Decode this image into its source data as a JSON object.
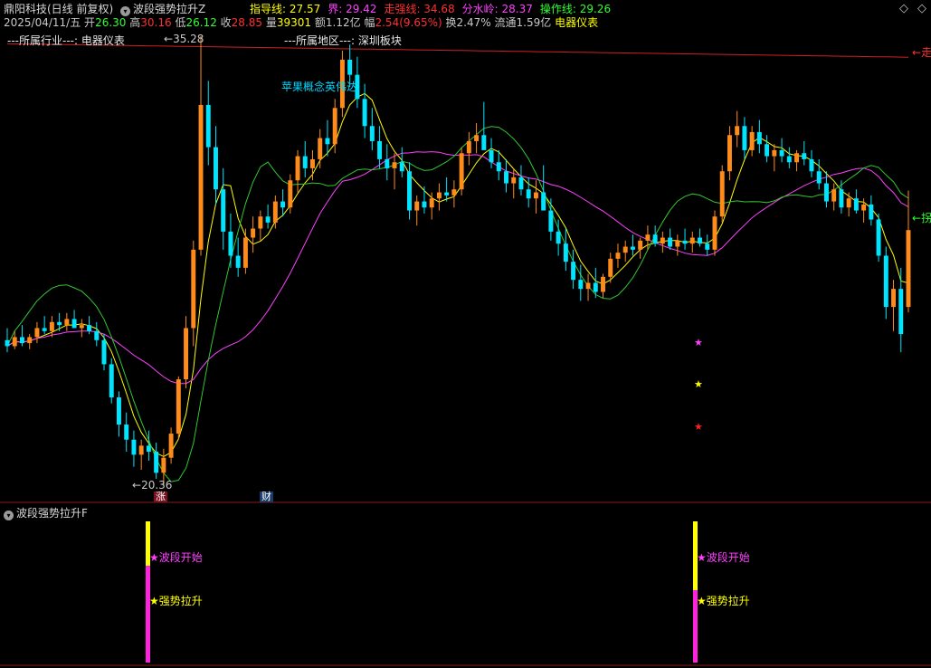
{
  "header": {
    "title": "鼎阳科技(日线 前复权)",
    "indicator_name": "波段强势拉升Z",
    "indicators": [
      {
        "label": "指导线:",
        "value": "27.57",
        "color": "#ffff00"
      },
      {
        "label": "界:",
        "value": "29.42",
        "color": "#ff40ff"
      },
      {
        "label": "走强线:",
        "value": "34.68",
        "color": "#ff3030"
      },
      {
        "label": "分水岭:",
        "value": "28.37",
        "color": "#ff40ff"
      },
      {
        "label": "操作线:",
        "value": "29.26",
        "color": "#30ff30"
      }
    ],
    "expand_icon": "diamond-icon"
  },
  "quote": {
    "date": "2025/04/11/五",
    "open_label": "开",
    "open": "26.30",
    "high_label": "高",
    "high": "30.16",
    "low_label": "低",
    "low": "26.12",
    "close_label": "收",
    "close": "28.85",
    "volume_label": "量",
    "volume": "39301",
    "amount_label": "额",
    "amount": "1.12亿",
    "change_label": "幅",
    "change": "2.54(9.65%)",
    "turnover_label": "换",
    "turnover": "2.47%",
    "float_label": "流通",
    "float": "1.59亿",
    "industry": "电器仪表"
  },
  "info": {
    "industry_line": "---所属行业---: 电器仪表",
    "region_line": "---所属地区---: 深圳板块",
    "concept_text": "苹果概念英伟达"
  },
  "chart_labels": {
    "high_marker": "35.28",
    "low_marker": "20.36",
    "right_red_label": "走",
    "right_green_label": "拐",
    "badge_zhang": "涨",
    "badge_cai": "财"
  },
  "sub_panel": {
    "title": "波段强势拉升F",
    "signal_start": "波段开始",
    "signal_strong": "强势拉升"
  },
  "colors": {
    "up": "#ff8c1a",
    "down": "#00e5ff",
    "yellow": "#ffff00",
    "magenta": "#ff40ff",
    "green": "#30c830",
    "red": "#ff3030"
  },
  "chart_data": {
    "type": "candlestick",
    "ylim": [
      20.36,
      35.28
    ],
    "series": [
      {
        "name": "指导线",
        "color": "#ffff00",
        "last": 27.57
      },
      {
        "name": "界",
        "color": "#ff40ff",
        "last": 29.42
      },
      {
        "name": "走强线",
        "color": "#ff3030",
        "last": 34.68
      },
      {
        "name": "分水岭",
        "color": "#ff40ff",
        "last": 28.37
      },
      {
        "name": "操作线",
        "color": "#30ff30",
        "last": 29.26
      }
    ],
    "candles_ohlc": [
      [
        25.2,
        25.6,
        24.8,
        25.0
      ],
      [
        25.0,
        25.5,
        24.9,
        25.3
      ],
      [
        25.3,
        25.7,
        25.0,
        25.1
      ],
      [
        25.1,
        25.4,
        24.9,
        25.3
      ],
      [
        25.3,
        25.8,
        25.1,
        25.6
      ],
      [
        25.6,
        26.0,
        25.4,
        25.5
      ],
      [
        25.5,
        26.0,
        25.3,
        25.8
      ],
      [
        25.8,
        26.1,
        25.5,
        25.7
      ],
      [
        25.7,
        26.1,
        25.5,
        25.9
      ],
      [
        25.9,
        26.2,
        25.6,
        25.6
      ],
      [
        25.6,
        25.9,
        25.3,
        25.7
      ],
      [
        25.7,
        26.0,
        25.4,
        25.5
      ],
      [
        25.5,
        25.8,
        25.0,
        25.2
      ],
      [
        25.2,
        25.4,
        24.2,
        24.4
      ],
      [
        24.4,
        24.6,
        23.1,
        23.3
      ],
      [
        23.3,
        23.5,
        22.0,
        22.4
      ],
      [
        22.4,
        22.8,
        21.5,
        21.9
      ],
      [
        21.9,
        22.2,
        21.0,
        21.4
      ],
      [
        21.4,
        21.9,
        20.9,
        21.7
      ],
      [
        21.7,
        22.2,
        21.2,
        21.5
      ],
      [
        21.5,
        21.8,
        20.6,
        20.8
      ],
      [
        20.8,
        21.6,
        20.36,
        21.3
      ],
      [
        21.3,
        22.3,
        21.1,
        22.1
      ],
      [
        22.1,
        24.0,
        21.9,
        23.9
      ],
      [
        23.9,
        26.0,
        23.6,
        25.6
      ],
      [
        25.6,
        28.5,
        25.0,
        28.2
      ],
      [
        28.2,
        35.28,
        28.0,
        33.0
      ],
      [
        33.0,
        33.8,
        31.0,
        31.6
      ],
      [
        31.6,
        32.3,
        29.7,
        30.2
      ],
      [
        30.2,
        30.9,
        28.2,
        28.8
      ],
      [
        28.8,
        29.4,
        27.6,
        28.0
      ],
      [
        28.0,
        28.6,
        27.3,
        27.6
      ],
      [
        27.6,
        28.9,
        27.4,
        28.6
      ],
      [
        28.6,
        29.3,
        28.1,
        28.9
      ],
      [
        28.9,
        29.5,
        28.5,
        29.3
      ],
      [
        29.3,
        29.7,
        28.9,
        29.1
      ],
      [
        29.1,
        30.0,
        28.9,
        29.8
      ],
      [
        29.8,
        30.2,
        29.3,
        29.6
      ],
      [
        29.6,
        30.7,
        29.4,
        30.5
      ],
      [
        30.5,
        31.5,
        30.1,
        31.3
      ],
      [
        31.3,
        31.8,
        30.6,
        30.9
      ],
      [
        30.9,
        31.5,
        30.5,
        31.2
      ],
      [
        31.2,
        32.2,
        30.9,
        31.9
      ],
      [
        31.9,
        32.5,
        31.3,
        31.7
      ],
      [
        31.7,
        33.2,
        31.4,
        32.9
      ],
      [
        32.9,
        34.8,
        32.6,
        34.5
      ],
      [
        34.5,
        35.0,
        33.6,
        34.0
      ],
      [
        34.0,
        34.6,
        32.9,
        33.2
      ],
      [
        33.2,
        33.7,
        31.9,
        32.3
      ],
      [
        32.3,
        32.9,
        31.5,
        31.8
      ],
      [
        31.8,
        32.3,
        30.9,
        31.2
      ],
      [
        31.2,
        31.7,
        30.5,
        30.9
      ],
      [
        30.9,
        31.4,
        30.2,
        31.1
      ],
      [
        31.1,
        31.6,
        30.6,
        30.8
      ],
      [
        30.8,
        31.1,
        29.2,
        29.5
      ],
      [
        29.5,
        30.0,
        29.0,
        29.8
      ],
      [
        29.8,
        30.3,
        29.4,
        29.6
      ],
      [
        29.6,
        30.1,
        29.2,
        29.9
      ],
      [
        29.9,
        30.4,
        29.5,
        30.1
      ],
      [
        30.1,
        30.6,
        29.8,
        30.0
      ],
      [
        30.0,
        30.5,
        29.6,
        30.2
      ],
      [
        30.2,
        31.6,
        30.0,
        31.4
      ],
      [
        31.4,
        32.1,
        31.0,
        31.8
      ],
      [
        31.8,
        32.4,
        31.4,
        32.0
      ],
      [
        32.0,
        33.1,
        31.7,
        31.5
      ],
      [
        31.5,
        31.9,
        30.9,
        31.1
      ],
      [
        31.1,
        31.5,
        30.5,
        30.8
      ],
      [
        30.8,
        31.2,
        30.1,
        30.4
      ],
      [
        30.4,
        30.9,
        29.9,
        30.6
      ],
      [
        30.6,
        31.0,
        30.0,
        30.2
      ],
      [
        30.2,
        30.6,
        29.6,
        29.9
      ],
      [
        29.9,
        30.5,
        29.4,
        30.1
      ],
      [
        30.1,
        31.0,
        29.7,
        29.5
      ],
      [
        29.5,
        29.9,
        28.5,
        28.8
      ],
      [
        28.8,
        29.2,
        28.0,
        28.4
      ],
      [
        28.4,
        28.9,
        27.5,
        27.8
      ],
      [
        27.8,
        28.2,
        26.9,
        27.2
      ],
      [
        27.2,
        27.7,
        26.5,
        26.9
      ],
      [
        26.9,
        27.4,
        26.5,
        27.1
      ],
      [
        27.1,
        27.6,
        26.6,
        26.8
      ],
      [
        26.8,
        27.4,
        26.6,
        27.3
      ],
      [
        27.3,
        28.1,
        27.1,
        27.9
      ],
      [
        27.9,
        28.4,
        27.6,
        28.1
      ],
      [
        28.1,
        28.5,
        27.8,
        28.3
      ],
      [
        28.3,
        28.7,
        28.0,
        28.2
      ],
      [
        28.2,
        28.6,
        27.9,
        28.5
      ],
      [
        28.5,
        29.0,
        28.2,
        28.7
      ],
      [
        28.7,
        29.0,
        28.3,
        28.4
      ],
      [
        28.4,
        28.8,
        28.1,
        28.6
      ],
      [
        28.6,
        28.9,
        28.2,
        28.3
      ],
      [
        28.3,
        28.7,
        28.0,
        28.5
      ],
      [
        28.5,
        28.9,
        28.2,
        28.4
      ],
      [
        28.4,
        28.8,
        28.1,
        28.6
      ],
      [
        28.6,
        28.9,
        28.3,
        28.4
      ],
      [
        28.4,
        28.7,
        28.0,
        28.2
      ],
      [
        28.2,
        29.5,
        28.0,
        29.3
      ],
      [
        29.3,
        31.0,
        29.1,
        30.8
      ],
      [
        30.8,
        32.3,
        30.5,
        32.0
      ],
      [
        32.0,
        32.8,
        31.6,
        32.3
      ],
      [
        32.3,
        32.6,
        31.2,
        31.5
      ],
      [
        31.5,
        32.3,
        31.3,
        32.1
      ],
      [
        32.1,
        32.5,
        31.4,
        31.7
      ],
      [
        31.7,
        32.0,
        31.1,
        31.3
      ],
      [
        31.3,
        31.7,
        30.8,
        31.5
      ],
      [
        31.5,
        31.9,
        31.1,
        31.3
      ],
      [
        31.3,
        31.6,
        30.9,
        31.1
      ],
      [
        31.1,
        31.5,
        30.8,
        31.4
      ],
      [
        31.4,
        31.8,
        31.0,
        31.2
      ],
      [
        31.2,
        31.5,
        30.6,
        30.8
      ],
      [
        30.8,
        31.2,
        30.2,
        30.4
      ],
      [
        30.4,
        30.8,
        29.6,
        29.8
      ],
      [
        29.8,
        30.4,
        29.5,
        30.2
      ],
      [
        30.2,
        30.5,
        29.4,
        29.6
      ],
      [
        29.6,
        30.1,
        29.3,
        29.9
      ],
      [
        29.9,
        30.2,
        29.4,
        29.5
      ],
      [
        29.5,
        29.9,
        29.1,
        29.7
      ],
      [
        29.7,
        30.0,
        29.0,
        29.2
      ],
      [
        29.2,
        29.4,
        27.8,
        28.0
      ],
      [
        28.0,
        28.3,
        25.9,
        26.3
      ],
      [
        26.3,
        27.2,
        25.5,
        26.9
      ],
      [
        26.9,
        27.6,
        24.8,
        25.4
      ],
      [
        26.3,
        30.16,
        26.12,
        28.85
      ]
    ]
  }
}
